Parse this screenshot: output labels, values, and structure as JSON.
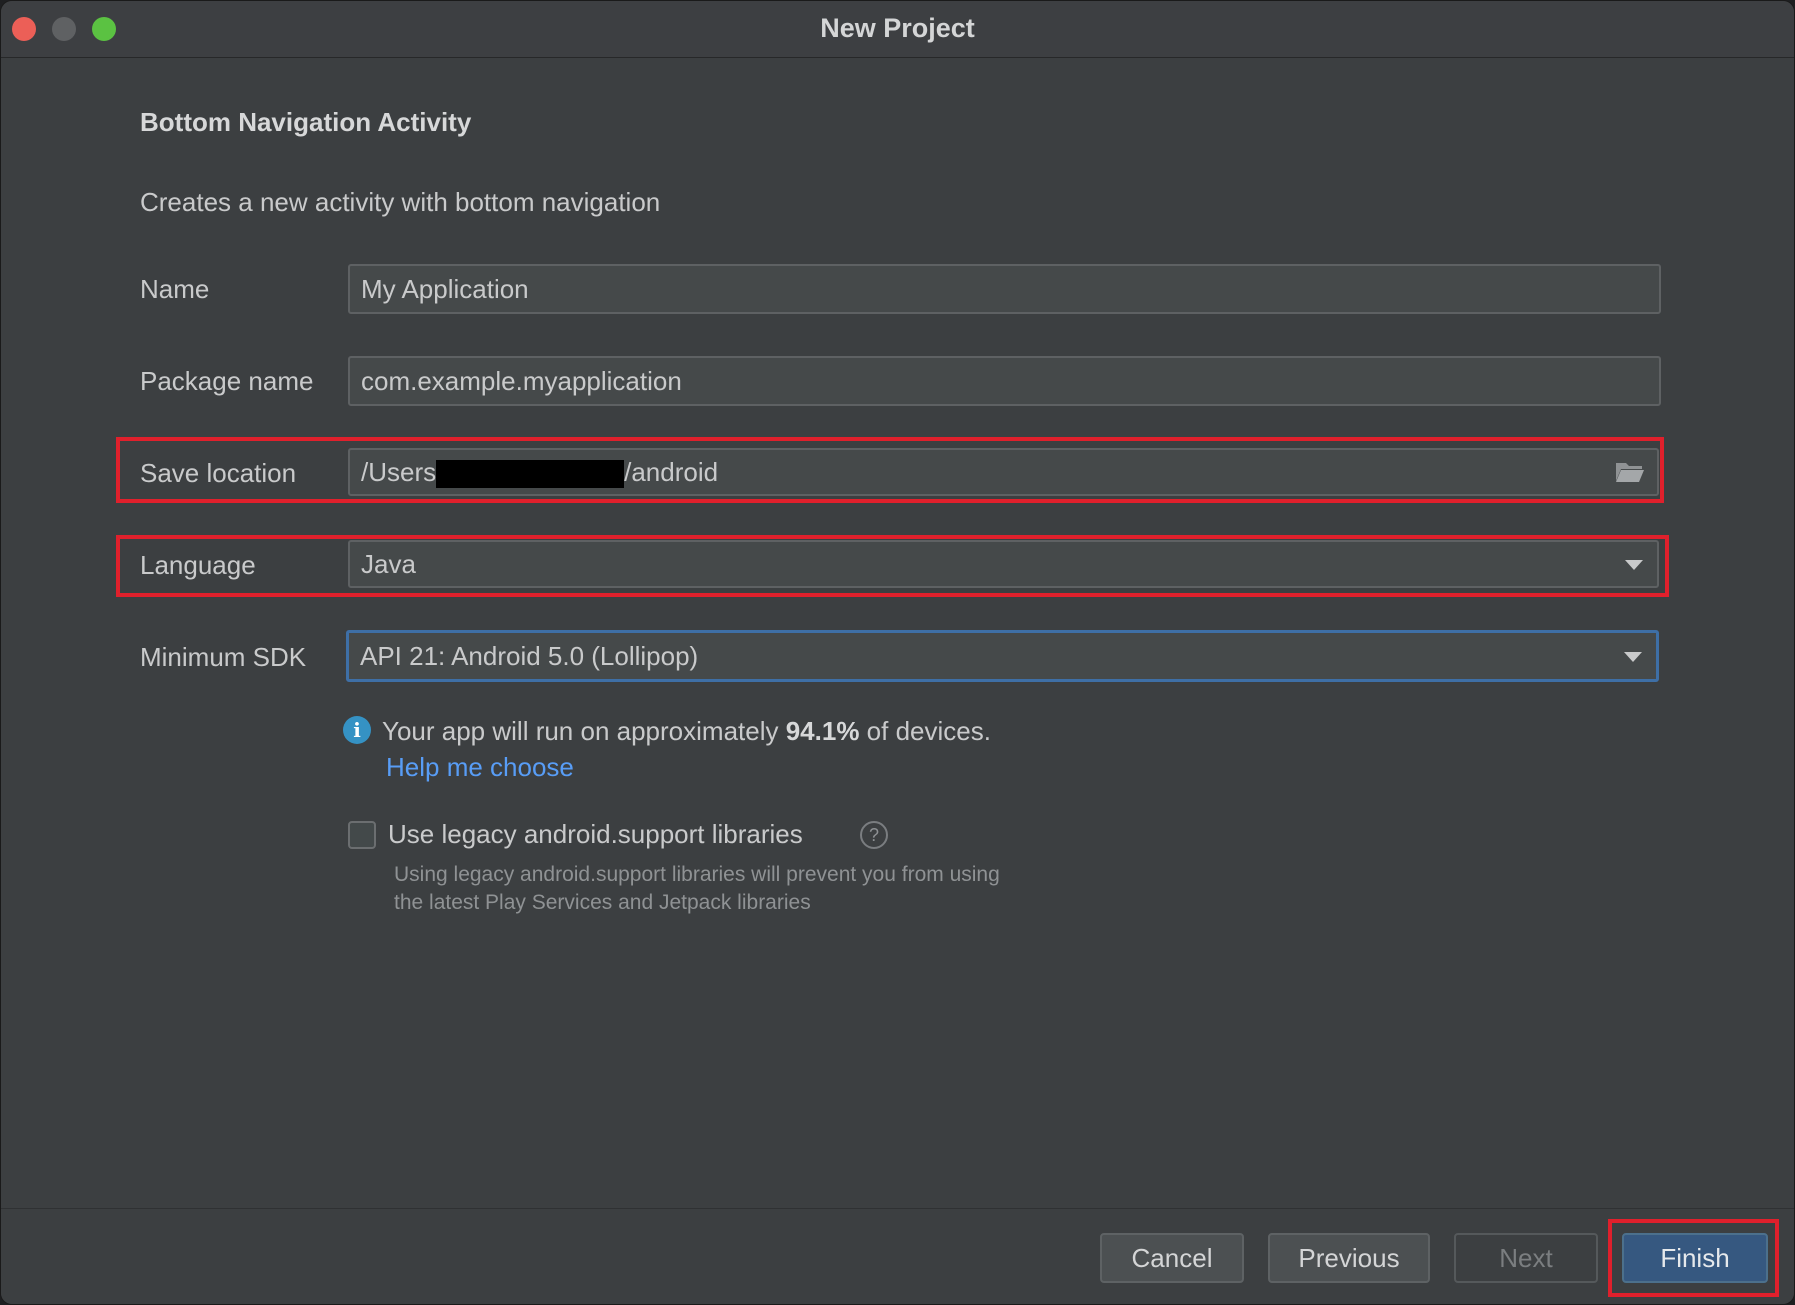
{
  "window": {
    "title": "New Project"
  },
  "template": {
    "heading": "Bottom Navigation Activity",
    "description": "Creates a new activity with bottom navigation"
  },
  "form": {
    "name": {
      "label": "Name",
      "value": "My Application"
    },
    "package": {
      "label": "Package name",
      "value": "com.example.myapplication"
    },
    "save_location": {
      "label": "Save location",
      "prefix": "/Users",
      "suffix": "/android",
      "browse_icon": "folder-icon"
    },
    "language": {
      "label": "Language",
      "value": "Java"
    },
    "min_sdk": {
      "label": "Minimum SDK",
      "value": "API 21: Android 5.0 (Lollipop)"
    }
  },
  "info": {
    "icon": "info-icon",
    "text_before": "Your app will run on approximately ",
    "percent": "94.1%",
    "text_after": " of devices.",
    "link": "Help me choose"
  },
  "legacy": {
    "checked": false,
    "label": "Use legacy android.support libraries",
    "help_icon": "?",
    "help_line1": "Using legacy android.support libraries will prevent you from using",
    "help_line2": "the latest Play Services and Jetpack libraries"
  },
  "buttons": {
    "cancel": "Cancel",
    "previous": "Previous",
    "next": "Next",
    "finish": "Finish"
  },
  "colors": {
    "background": "#3c3f41",
    "highlight": "#e0202c",
    "link": "#589df6",
    "primary_button": "#365880"
  }
}
